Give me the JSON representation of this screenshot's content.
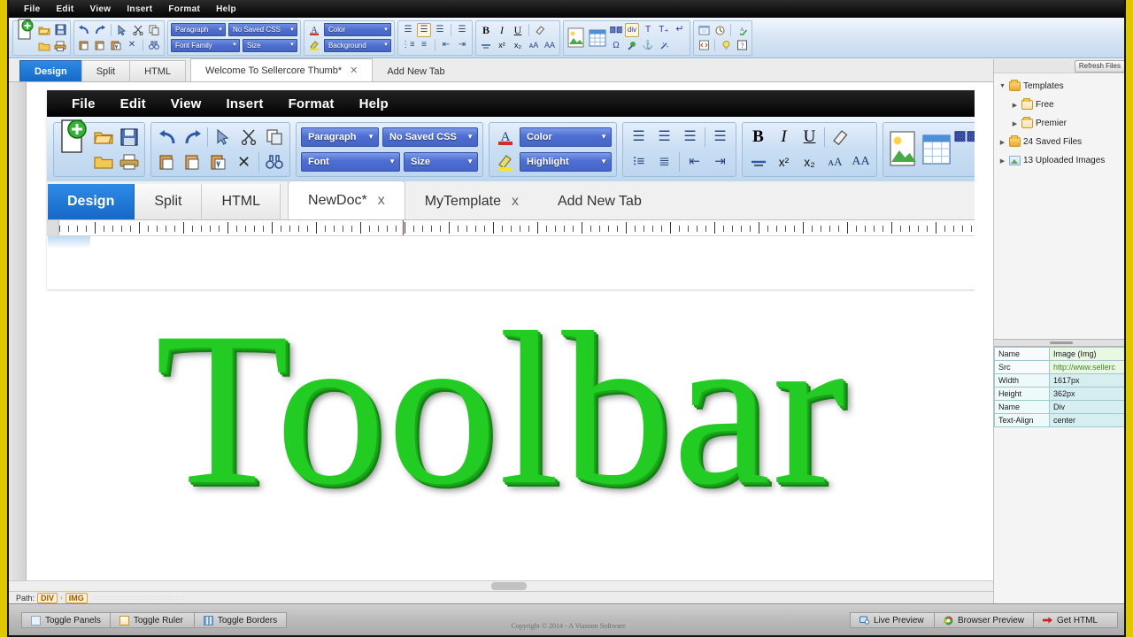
{
  "app": {
    "menu": [
      "File",
      "Edit",
      "View",
      "Insert",
      "Format",
      "Help"
    ],
    "accent_blue": "#1769c6",
    "dropdown_blue": "#4f6fd0",
    "frame_yellow": "#e0c800"
  },
  "toolbar": {
    "dropdowns": {
      "paragraph": "Paragraph",
      "saved_css": "No Saved CSS",
      "font_family": "Font Family",
      "size": "Size",
      "color": "Color",
      "background": "Background"
    },
    "icons": {
      "new": "new-document-icon",
      "open": "open-folder-icon",
      "save": "save-disk-icon",
      "open_folder2": "folder-icon",
      "print": "print-icon",
      "undo": "undo-icon",
      "redo": "redo-icon",
      "select": "cursor-select-icon",
      "cut": "scissors-icon",
      "copy": "copy-icon",
      "paste": "paste-icon",
      "paste_text": "paste-text-icon",
      "paste_word": "paste-word-icon",
      "delete": "x-delete-icon",
      "find": "binoculars-find-icon",
      "align_left": "align-left-icon",
      "align_center": "align-center-icon",
      "align_right": "align-right-icon",
      "align_justify": "align-justify-icon",
      "bullet_list": "bullet-list-icon",
      "number_list": "numbered-list-icon",
      "outdent": "outdent-icon",
      "indent": "indent-icon",
      "bold": "bold-icon",
      "italic": "italic-icon",
      "underline": "underline-icon",
      "eraser": "eraser-icon",
      "strike": "strikethrough-icon",
      "superscript": "superscript-icon",
      "subscript": "subscript-icon",
      "decrease_font": "decrease-font-icon",
      "increase_font": "increase-font-icon",
      "insert_image": "insert-image-icon",
      "insert_table": "insert-table-icon",
      "insert_div": "insert-div-icon",
      "insert_span": "insert-span-icon",
      "text_tool": "text-tool-icon",
      "text_field": "text-field-icon",
      "line_break": "line-break-icon",
      "symbol": "omega-symbol-icon",
      "link": "hyperlink-icon",
      "anchor": "anchor-icon",
      "unlink": "unlink-icon",
      "calendar": "calendar-icon",
      "clock": "clock-icon",
      "spell": "spell-check-icon",
      "code": "code-icon",
      "tip": "lightbulb-tip-icon",
      "help": "help-icon"
    }
  },
  "tabs": {
    "view_modes": [
      "Design",
      "Split",
      "HTML"
    ],
    "active_view": "Design",
    "documents": [
      {
        "label": "Welcome To Sellercore Thumb*",
        "closable": true,
        "active": true
      }
    ],
    "add_tab": "Add New Tab"
  },
  "canvas": {
    "screenshot": {
      "menu": [
        "File",
        "Edit",
        "View",
        "Insert",
        "Format",
        "Help"
      ],
      "dropdowns": {
        "paragraph": "Paragraph",
        "saved_css": "No Saved CSS",
        "font": "Font",
        "size": "Size",
        "color": "Color",
        "highlight": "Highlight"
      },
      "view_modes": [
        "Design",
        "Split",
        "HTML"
      ],
      "active_view": "Design",
      "documents": [
        {
          "label": "NewDoc*",
          "closable": true,
          "active": true
        },
        {
          "label": "MyTemplate",
          "closable": true,
          "active": false
        }
      ],
      "add_tab": "Add New Tab"
    },
    "headline": "Toolbar",
    "headline_color": "#22cc22"
  },
  "path_bar": {
    "label": "Path:",
    "segments": [
      "DIV",
      "IMG"
    ],
    "separator": "›",
    "ghost": "ghost-text-overlay"
  },
  "right_panel": {
    "refresh_button": "Refresh Files",
    "tree": [
      {
        "label": "Templates",
        "level": 1,
        "expanded": true,
        "icon": "folder-open-icon"
      },
      {
        "label": "Free",
        "level": 2,
        "expanded": false,
        "icon": "folder-icon"
      },
      {
        "label": "Premier",
        "level": 2,
        "expanded": false,
        "icon": "folder-icon"
      },
      {
        "label": "24 Saved Files",
        "level": 1,
        "expanded": false,
        "icon": "folder-open-icon"
      },
      {
        "label": "13 Uploaded Images",
        "level": 1,
        "expanded": false,
        "icon": "image-icon"
      }
    ],
    "properties": [
      {
        "key": "Name",
        "value": "Image (Img)"
      },
      {
        "key": "Src",
        "value": "http://www.sellerc"
      },
      {
        "key": "Width",
        "value": "1617px"
      },
      {
        "key": "Height",
        "value": "362px"
      },
      {
        "key": "Name",
        "value": "Div"
      },
      {
        "key": "Text-Align",
        "value": "center"
      }
    ]
  },
  "bottom_bar": {
    "left_buttons": [
      {
        "label": "Toggle Panels",
        "icon": "panels-icon"
      },
      {
        "label": "Toggle Ruler",
        "icon": "ruler-icon"
      },
      {
        "label": "Toggle Borders",
        "icon": "borders-icon"
      }
    ],
    "right_buttons": [
      {
        "label": "Live Preview",
        "icon": "live-preview-icon"
      },
      {
        "label": "Browser Preview",
        "icon": "browser-icon"
      },
      {
        "label": "Get HTML",
        "icon": "arrow-right-icon"
      }
    ],
    "copyright": "Copyright © 2014 - A Viasoon Software"
  }
}
